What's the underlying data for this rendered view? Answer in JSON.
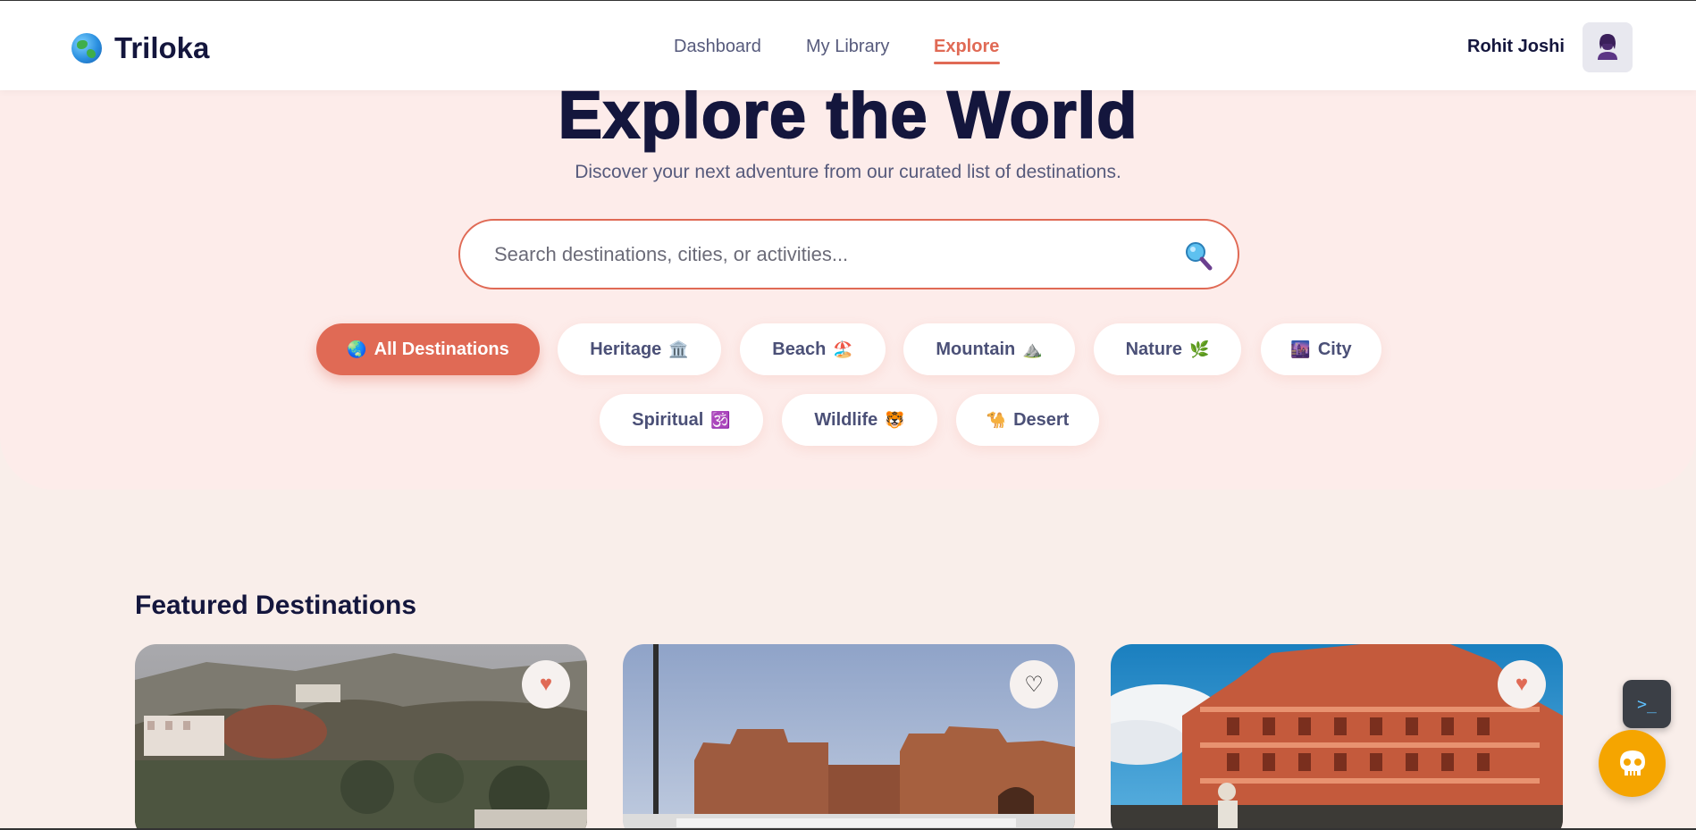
{
  "brand": {
    "name": "Triloka",
    "logo_icon": "globe-icon"
  },
  "nav": {
    "links": [
      {
        "label": "Dashboard",
        "active": false
      },
      {
        "label": "My Library",
        "active": false
      },
      {
        "label": "Explore",
        "active": true
      }
    ],
    "user_name": "Rohit Joshi",
    "avatar_icon": "user-icon"
  },
  "hero": {
    "title": "Explore the World",
    "subtitle": "Discover your next adventure from our curated list of destinations."
  },
  "search": {
    "placeholder": "Search destinations, cities, or activities...",
    "value": "",
    "icon": "magnifier-icon"
  },
  "filters": [
    {
      "label": "All Destinations",
      "emoji": "🌏",
      "active": true
    },
    {
      "label": "Heritage",
      "emoji": "🏛️",
      "active": false
    },
    {
      "label": "Beach",
      "emoji": "🏖️",
      "active": false
    },
    {
      "label": "Mountain",
      "emoji": "⛰️",
      "active": false
    },
    {
      "label": "Nature",
      "emoji": "🌿",
      "active": false
    },
    {
      "label": "City",
      "emoji": "🌆",
      "active": false
    },
    {
      "label": "Spiritual",
      "emoji": "🕉️",
      "active": false
    },
    {
      "label": "Wildlife",
      "emoji": "🐯",
      "active": false
    },
    {
      "label": "Desert",
      "emoji": "🐪",
      "active": false
    }
  ],
  "featured": {
    "title": "Featured Destinations",
    "cards": [
      {
        "image": "hill-fort-photo",
        "favorited": true
      },
      {
        "image": "desert-fort-photo",
        "favorited": false
      },
      {
        "image": "hawa-mahal-photo",
        "favorited": true
      }
    ]
  },
  "colors": {
    "accent": "#e06a55",
    "navy": "#14163d",
    "hero_bg": "#fdecea",
    "page_bg": "#f9eeea",
    "bot_button": "#f5a500"
  },
  "floating": {
    "terminal_icon": "terminal-icon",
    "bot_icon": "skull-bot-icon"
  }
}
